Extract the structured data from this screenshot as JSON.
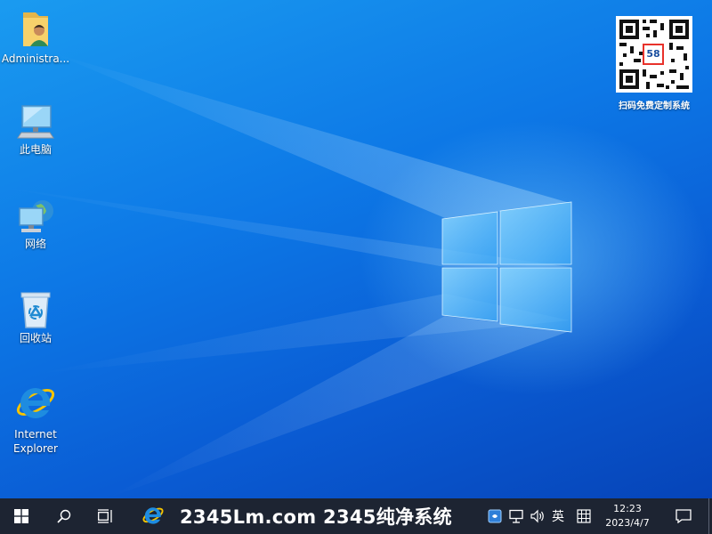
{
  "desktop": {
    "icons": [
      {
        "label": "Administra..."
      },
      {
        "label": "此电脑"
      },
      {
        "label": "网络"
      },
      {
        "label": "回收站"
      },
      {
        "label": "Internet Explorer"
      }
    ],
    "qr": {
      "badge": "58",
      "caption": "扫码免费定制系统"
    }
  },
  "taskbar": {
    "banner": "2345Lm.com 2345纯净系统",
    "ime_lang": "英",
    "clock_time": "12:23",
    "clock_date": "2023/4/7"
  },
  "colors": {
    "taskbar_bg": "#1d2432",
    "desktop_blue": "#0d78e6",
    "ie_blue": "#1e8ce0",
    "ie_ring": "#f5c400"
  },
  "icon_names": [
    "user-folder-icon",
    "computer-icon",
    "network-icon",
    "recycle-bin-icon",
    "internet-explorer-icon",
    "windows-logo-icon",
    "search-icon",
    "task-view-icon",
    "security-icon",
    "network-tray-icon",
    "volume-icon",
    "ime-mode-icon",
    "notification-icon"
  ]
}
